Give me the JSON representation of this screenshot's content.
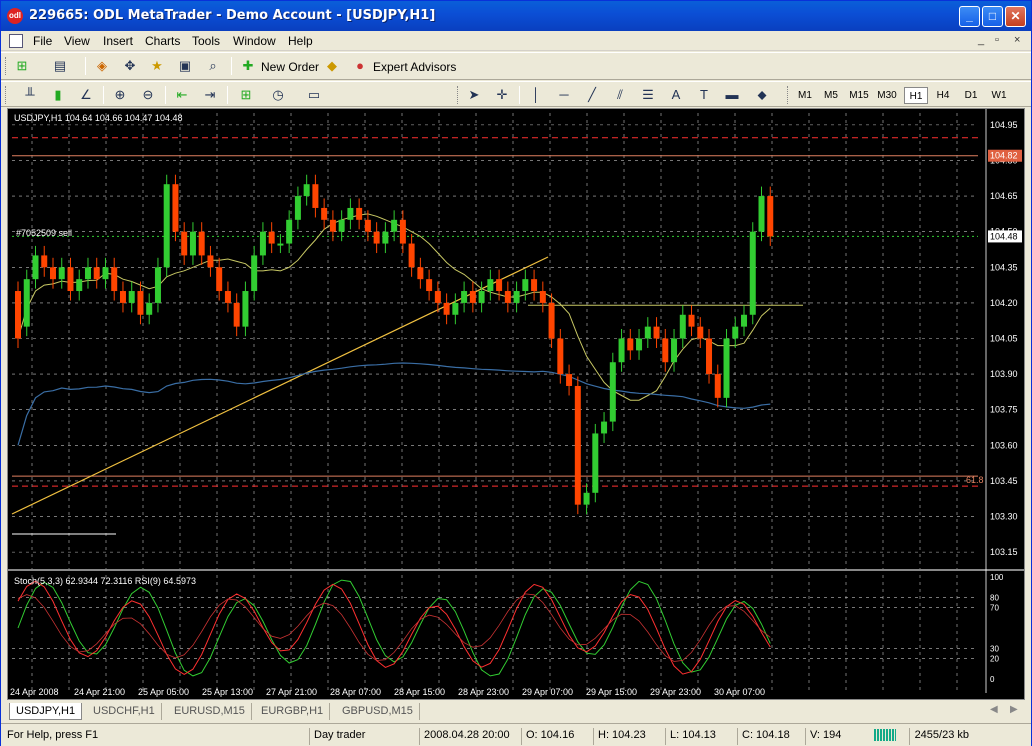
{
  "window": {
    "title": "229665: ODL MetaTrader - Demo Account - [USDJPY,H1]",
    "app_icon_text": "odl",
    "buttons": {
      "minimize": "_",
      "maximize": "□",
      "close": "✕"
    }
  },
  "menu": {
    "items": [
      "File",
      "View",
      "Insert",
      "Charts",
      "Tools",
      "Window",
      "Help"
    ],
    "mdi": {
      "minimize": "_",
      "restore": "▫",
      "close": "×"
    }
  },
  "toolbar1": {
    "new_order": "New Order",
    "expert_advisors": "Expert Advisors"
  },
  "toolbar2": {
    "timeframes": [
      "M1",
      "M5",
      "M15",
      "M30",
      "H1",
      "H4",
      "D1",
      "W1"
    ],
    "active_timeframe": "H1",
    "text_tool": "A",
    "label_tool": "T"
  },
  "chart": {
    "header": "USDJPY,H1  104.64 104.66 104.47 104.48",
    "order_label": "#7052509 sell",
    "fib_label": "61.8",
    "price_ticks": [
      "104.95",
      "104.80",
      "104.65",
      "104.50",
      "104.35",
      "104.20",
      "104.05",
      "103.90",
      "103.75",
      "103.60",
      "103.45",
      "103.30",
      "103.15"
    ],
    "current_price": "104.48",
    "alert_price": "104.82",
    "indicator_header": "Stoch(5,3,3) 62.9344 72.3116  RSI(9) 64.5973",
    "indicator_ticks": [
      "100",
      "80",
      "70",
      "30",
      "20",
      "0"
    ],
    "time_labels": [
      "24 Apr 2008",
      "24 Apr 21:00",
      "25 Apr 05:00",
      "25 Apr 13:00",
      "27 Apr 21:00",
      "28 Apr 07:00",
      "28 Apr 15:00",
      "28 Apr 23:00",
      "29 Apr 07:00",
      "29 Apr 15:00",
      "29 Apr 23:00",
      "30 Apr 07:00"
    ],
    "colors": {
      "bull": "#32cd32",
      "bear": "#ff4500",
      "grid": "#c0c0c0",
      "ma_fast": "#c8c864",
      "ma_slow": "#3a6ea5",
      "trend": "#f0c040"
    }
  },
  "chart_data": {
    "type": "candlestick",
    "symbol": "USDJPY",
    "timeframe": "H1",
    "ylim": [
      103.1,
      105.0
    ],
    "y_ticks": [
      104.95,
      104.8,
      104.65,
      104.5,
      104.35,
      104.2,
      104.05,
      103.9,
      103.75,
      103.6,
      103.45,
      103.3,
      103.15
    ],
    "candles": [
      [
        104.25,
        104.05
      ],
      [
        104.1,
        104.3
      ],
      [
        104.3,
        104.4
      ],
      [
        104.4,
        104.35
      ],
      [
        104.35,
        104.3
      ],
      [
        104.3,
        104.35
      ],
      [
        104.35,
        104.25
      ],
      [
        104.25,
        104.3
      ],
      [
        104.3,
        104.35
      ],
      [
        104.35,
        104.3
      ],
      [
        104.3,
        104.35
      ],
      [
        104.35,
        104.25
      ],
      [
        104.25,
        104.2
      ],
      [
        104.2,
        104.25
      ],
      [
        104.25,
        104.15
      ],
      [
        104.15,
        104.2
      ],
      [
        104.2,
        104.35
      ],
      [
        104.35,
        104.7
      ],
      [
        104.7,
        104.5
      ],
      [
        104.5,
        104.4
      ],
      [
        104.4,
        104.5
      ],
      [
        104.5,
        104.4
      ],
      [
        104.4,
        104.35
      ],
      [
        104.35,
        104.25
      ],
      [
        104.25,
        104.2
      ],
      [
        104.2,
        104.1
      ],
      [
        104.1,
        104.25
      ],
      [
        104.25,
        104.4
      ],
      [
        104.4,
        104.5
      ],
      [
        104.5,
        104.45
      ],
      [
        104.45,
        104.45
      ],
      [
        104.45,
        104.55
      ],
      [
        104.55,
        104.65
      ],
      [
        104.65,
        104.7
      ],
      [
        104.7,
        104.6
      ],
      [
        104.6,
        104.55
      ],
      [
        104.55,
        104.5
      ],
      [
        104.5,
        104.55
      ],
      [
        104.55,
        104.6
      ],
      [
        104.6,
        104.55
      ],
      [
        104.55,
        104.5
      ],
      [
        104.5,
        104.45
      ],
      [
        104.45,
        104.5
      ],
      [
        104.5,
        104.55
      ],
      [
        104.55,
        104.45
      ],
      [
        104.45,
        104.35
      ],
      [
        104.35,
        104.3
      ],
      [
        104.3,
        104.25
      ],
      [
        104.25,
        104.2
      ],
      [
        104.2,
        104.15
      ],
      [
        104.15,
        104.2
      ],
      [
        104.2,
        104.25
      ],
      [
        104.25,
        104.2
      ],
      [
        104.2,
        104.25
      ],
      [
        104.25,
        104.3
      ],
      [
        104.3,
        104.25
      ],
      [
        104.25,
        104.2
      ],
      [
        104.2,
        104.25
      ],
      [
        104.25,
        104.3
      ],
      [
        104.3,
        104.25
      ],
      [
        104.25,
        104.2
      ],
      [
        104.2,
        104.05
      ],
      [
        104.05,
        103.9
      ],
      [
        103.9,
        103.85
      ],
      [
        103.85,
        103.35
      ],
      [
        103.35,
        103.4
      ],
      [
        103.4,
        103.65
      ],
      [
        103.65,
        103.7
      ],
      [
        103.7,
        103.95
      ],
      [
        103.95,
        104.05
      ],
      [
        104.05,
        104.0
      ],
      [
        104.0,
        104.05
      ],
      [
        104.05,
        104.1
      ],
      [
        104.1,
        104.05
      ],
      [
        104.05,
        103.95
      ],
      [
        103.95,
        104.05
      ],
      [
        104.05,
        104.15
      ],
      [
        104.15,
        104.1
      ],
      [
        104.1,
        104.05
      ],
      [
        104.05,
        103.9
      ],
      [
        103.9,
        103.8
      ],
      [
        103.8,
        104.05
      ],
      [
        104.05,
        104.1
      ],
      [
        104.1,
        104.15
      ],
      [
        104.15,
        104.5
      ],
      [
        104.5,
        104.65
      ],
      [
        104.65,
        104.48
      ]
    ],
    "candle_fields": [
      "open",
      "close"
    ],
    "lines": {
      "order_level": 104.48,
      "alert_level": 104.82,
      "fib_61_8": 103.47,
      "resistance": 104.19
    }
  },
  "tabs": [
    "USDJPY,H1",
    "USDCHF,H1",
    "EURUSD,M15",
    "EURGBP,H1",
    "GBPUSD,M15"
  ],
  "tabs_scroll": {
    "left": "◀",
    "right": "▶"
  },
  "status": {
    "help": "For Help, press F1",
    "profile": "Day trader",
    "datetime": "2008.04.28 20:00",
    "open": "O: 104.16",
    "high": "H: 104.23",
    "low": "L: 104.13",
    "close": "C: 104.18",
    "volume": "V: 194",
    "traffic": "2455/23 kb"
  }
}
